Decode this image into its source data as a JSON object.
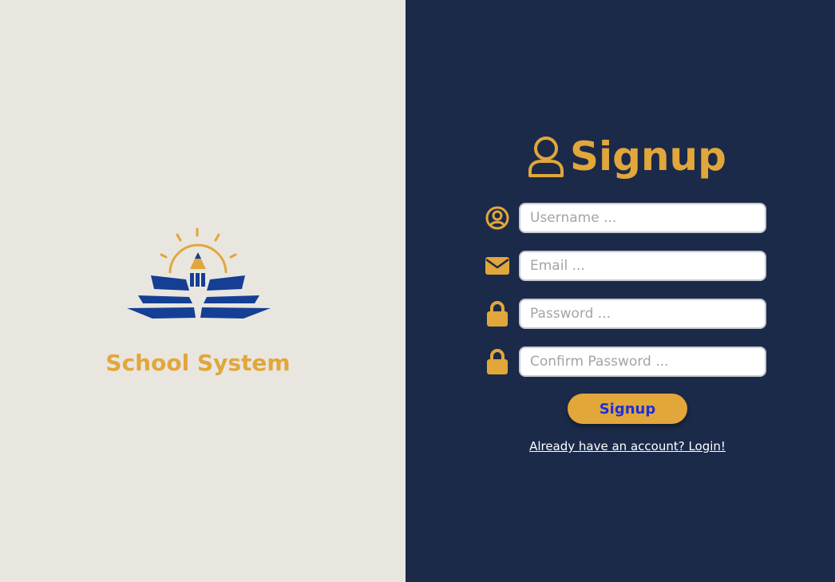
{
  "brand": {
    "name": "School System"
  },
  "form": {
    "title": "Signup",
    "username": {
      "placeholder": "Username ...",
      "value": ""
    },
    "email": {
      "placeholder": "Email ...",
      "value": ""
    },
    "password": {
      "placeholder": "Password ...",
      "value": ""
    },
    "confirm_password": {
      "placeholder": "Confirm Password ...",
      "value": ""
    },
    "submit_label": "Signup",
    "login_link": "Already have an account? Login!"
  },
  "icons": {
    "title": "user-icon",
    "username": "user-circle-icon",
    "email": "envelope-icon",
    "password": "lock-icon",
    "confirm_password": "lock-icon",
    "logo": "book-pencil-sun-logo"
  },
  "colors": {
    "left_background": "#e9e6e0",
    "right_background": "#1c2a4a",
    "accent_gold": "#e1a73b",
    "logo_blue": "#143f94",
    "button_text": "#1f2fd6"
  }
}
